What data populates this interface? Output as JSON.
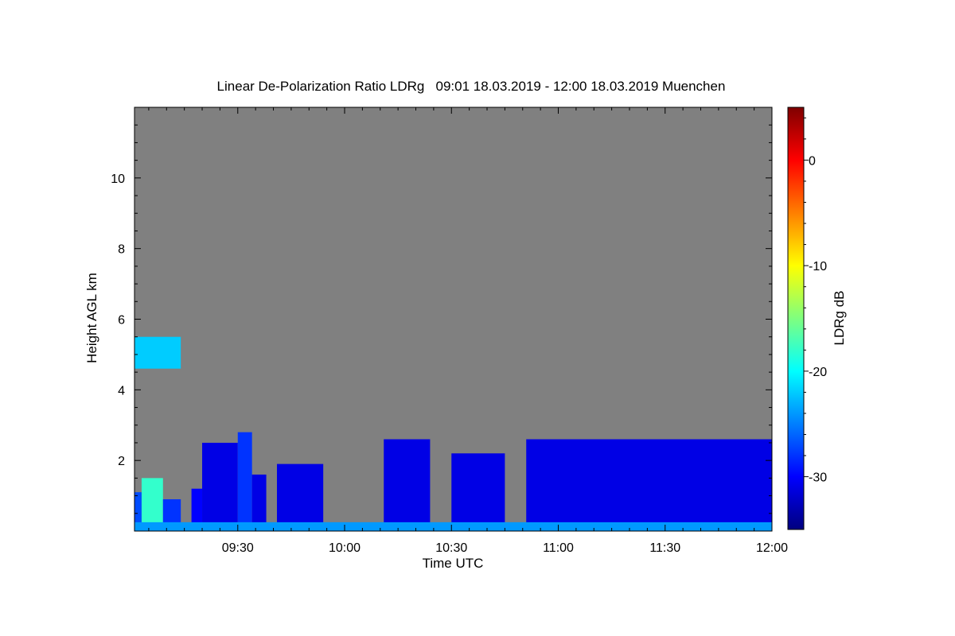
{
  "chart_data": {
    "type": "heatmap",
    "title": "Linear De-Polarization Ratio LDRg   09:01 18.03.2019 - 12:00 18.03.2019 Muenchen",
    "xlabel": "Time UTC",
    "ylabel": "Height AGL km",
    "colorbar_label": "LDRg dB",
    "x_tick_labels": [
      "09:30",
      "10:00",
      "10:30",
      "11:00",
      "11:30",
      "12:00"
    ],
    "x_ticks_minutes": [
      30,
      60,
      90,
      120,
      150,
      180
    ],
    "xlim_minutes": [
      1,
      180
    ],
    "y_tick_labels": [
      "2",
      "4",
      "6",
      "8",
      "10"
    ],
    "y_ticks": [
      2,
      4,
      6,
      8,
      10
    ],
    "ylim": [
      0,
      12
    ],
    "colorbar_ticks": [
      0,
      -10,
      -20,
      -30
    ],
    "colorbar_tick_labels": [
      "0",
      "-10",
      "-20",
      "-30"
    ],
    "colorbar_range": [
      -35,
      5
    ],
    "colormap": [
      "#00007f",
      "#0000ff",
      "#007fff",
      "#00ffff",
      "#7fff7f",
      "#ffff00",
      "#ff7f00",
      "#ff0000",
      "#7f0000"
    ],
    "no_signal_color": "#808080",
    "cloud_segments": [
      {
        "t0": 1,
        "t1": 3,
        "top": 1.1,
        "ldr": -27
      },
      {
        "t0": 3,
        "t1": 9,
        "top": 1.5,
        "ldr": -18
      },
      {
        "t0": 9,
        "t1": 14,
        "top": 0.9,
        "ldr": -28
      },
      {
        "t0": 17,
        "t1": 20,
        "top": 1.2,
        "ldr": -30
      },
      {
        "t0": 20,
        "t1": 30,
        "top": 2.5,
        "ldr": -31
      },
      {
        "t0": 30,
        "t1": 34,
        "top": 2.8,
        "ldr": -28
      },
      {
        "t0": 34,
        "t1": 38,
        "top": 1.6,
        "ldr": -31
      },
      {
        "t0": 41,
        "t1": 54,
        "top": 1.9,
        "ldr": -31
      },
      {
        "t0": 71,
        "t1": 84,
        "top": 2.6,
        "ldr": -31
      },
      {
        "t0": 90,
        "t1": 105,
        "top": 2.2,
        "ldr": -31
      },
      {
        "t0": 111,
        "t1": 181,
        "top": 2.6,
        "ldr": -31
      }
    ],
    "elevated_layer": {
      "t0": 1,
      "t1": 14,
      "bottom": 4.6,
      "top": 5.5,
      "ldr": -22
    },
    "surface_layer": {
      "t0": 1,
      "t1": 181,
      "top": 0.25,
      "ldr": -24
    }
  }
}
